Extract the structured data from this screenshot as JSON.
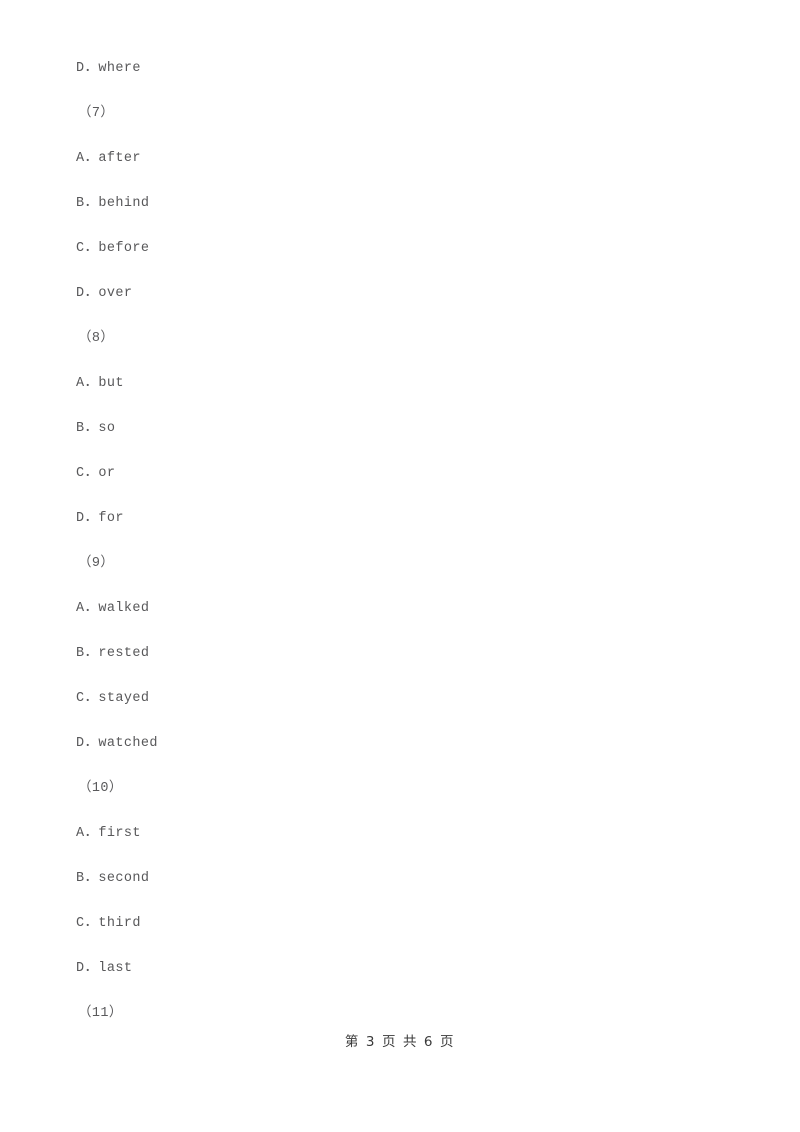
{
  "document": {
    "page_background": "#ffffff",
    "text_color": "#58585a",
    "footer_color": "#3a3a3a"
  },
  "content": {
    "lines": [
      {
        "kind": "option",
        "text": "D．where"
      },
      {
        "kind": "qnum",
        "text": "（7）"
      },
      {
        "kind": "option",
        "text": "A．after"
      },
      {
        "kind": "option",
        "text": "B．behind"
      },
      {
        "kind": "option",
        "text": "C．before"
      },
      {
        "kind": "option",
        "text": "D．over"
      },
      {
        "kind": "qnum",
        "text": "（8）"
      },
      {
        "kind": "option",
        "text": "A．but"
      },
      {
        "kind": "option",
        "text": "B．so"
      },
      {
        "kind": "option",
        "text": "C．or"
      },
      {
        "kind": "option",
        "text": "D．for"
      },
      {
        "kind": "qnum",
        "text": "（9）"
      },
      {
        "kind": "option",
        "text": "A．walked"
      },
      {
        "kind": "option",
        "text": "B．rested"
      },
      {
        "kind": "option",
        "text": "C．stayed"
      },
      {
        "kind": "option",
        "text": "D．watched"
      },
      {
        "kind": "qnum",
        "text": "（10）"
      },
      {
        "kind": "option",
        "text": "A．first"
      },
      {
        "kind": "option",
        "text": "B．second"
      },
      {
        "kind": "option",
        "text": "C．third"
      },
      {
        "kind": "option",
        "text": "D．last"
      },
      {
        "kind": "qnum",
        "text": "（11）"
      }
    ]
  },
  "footer": {
    "text": "第 3 页 共 6 页",
    "current_page": "3",
    "total_pages": "6"
  }
}
